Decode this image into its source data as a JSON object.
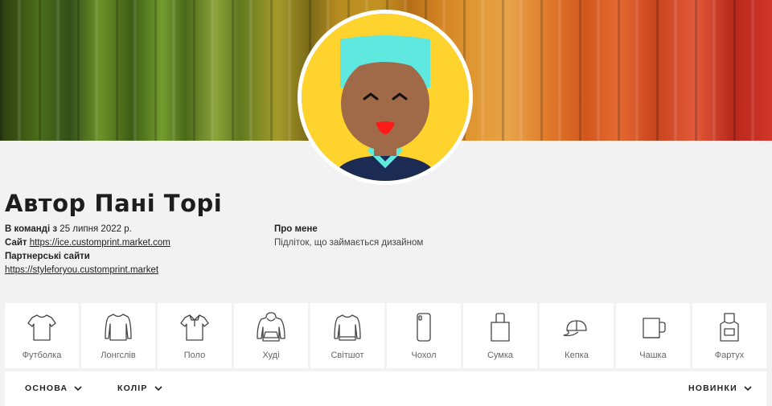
{
  "profile": {
    "author_name": "Автор Пані Торі",
    "joined_label": "В команді з",
    "joined_date": "25 липня 2022 р.",
    "site_label": "Сайт",
    "site_url": "https://ice.customprint.market.com",
    "partner_label": "Партнерські сайти",
    "partner_url": "https://styleforyou.customprint.market",
    "about_title": "Про мене",
    "about_text": "Підліток, що займається дизайном"
  },
  "categories": [
    {
      "label": "Футболка",
      "icon": "tshirt-icon"
    },
    {
      "label": "Лонгслів",
      "icon": "longsleeve-icon"
    },
    {
      "label": "Поло",
      "icon": "polo-icon"
    },
    {
      "label": "Худі",
      "icon": "hoodie-icon"
    },
    {
      "label": "Світшот",
      "icon": "sweatshirt-icon"
    },
    {
      "label": "Чохол",
      "icon": "phone-case-icon"
    },
    {
      "label": "Сумка",
      "icon": "bag-icon"
    },
    {
      "label": "Кепка",
      "icon": "cap-icon"
    },
    {
      "label": "Чашка",
      "icon": "mug-icon"
    },
    {
      "label": "Фартух",
      "icon": "apron-icon"
    }
  ],
  "filters": {
    "base_label": "ОСНОВА",
    "color_label": "КОЛІР",
    "sort_label": "НОВИНКИ"
  },
  "colors": {
    "avatar_bg": "#fed32e",
    "page_bg": "#f2f2f2"
  }
}
